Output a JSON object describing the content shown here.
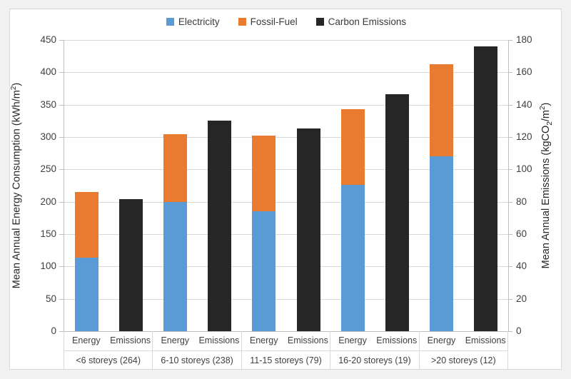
{
  "chart_data": {
    "type": "bar",
    "title": "",
    "subtitle": "",
    "grid": true,
    "legend_position": "top-center",
    "categories": [
      "<6 storeys (264)",
      "6-10 storeys (238)",
      "11-15 storeys (79)",
      "16-20 storeys (19)",
      ">20 storeys (12)"
    ],
    "subcategories": [
      "Energy",
      "Emissions"
    ],
    "series": [
      {
        "name": "Electricity",
        "color": "#5B9BD5",
        "axis": "left",
        "stack": "Energy",
        "values": [
          114,
          200,
          185,
          226,
          270
        ]
      },
      {
        "name": "Fossil-Fuel",
        "color": "#E97B31",
        "axis": "left",
        "stack": "Energy",
        "values": [
          101,
          104,
          117,
          117,
          143
        ]
      },
      {
        "name": "Carbon Emissions",
        "color": "#262626",
        "axis": "right",
        "stack": "Emissions",
        "values": [
          81.6,
          130.0,
          125.2,
          146.6,
          176.0
        ]
      }
    ],
    "energy_totals": [
      215,
      304,
      302,
      343,
      413
    ],
    "xlabel": "",
    "ylabel": "Mean Annual Energy Consumption (kWh/m2)",
    "y2label": "Mean Annual Emissions (kgCO2/m2)",
    "ylim": [
      0,
      450
    ],
    "y2lim": [
      0,
      180
    ],
    "yticks": [
      "0",
      "50",
      "100",
      "150",
      "200",
      "250",
      "300",
      "350",
      "400",
      "450"
    ],
    "y2ticks": [
      "0",
      "20",
      "40",
      "60",
      "80",
      "100",
      "120",
      "140",
      "160",
      "180"
    ]
  },
  "legend": {
    "items": [
      {
        "label": "Electricity",
        "color": "#5B9BD5"
      },
      {
        "label": "Fossil-Fuel",
        "color": "#E97B31"
      },
      {
        "label": "Carbon Emissions",
        "color": "#262626"
      }
    ]
  },
  "axes": {
    "left_title_parts": {
      "main": "Mean Annual Energy Consumption (kWh/m",
      "sup": "2",
      "tail": ")"
    },
    "right_title_parts": {
      "main": "Mean Annual Emissions (kgCO",
      "sub": "2",
      "mid": "/m",
      "sup": "2",
      "tail": ")"
    }
  }
}
